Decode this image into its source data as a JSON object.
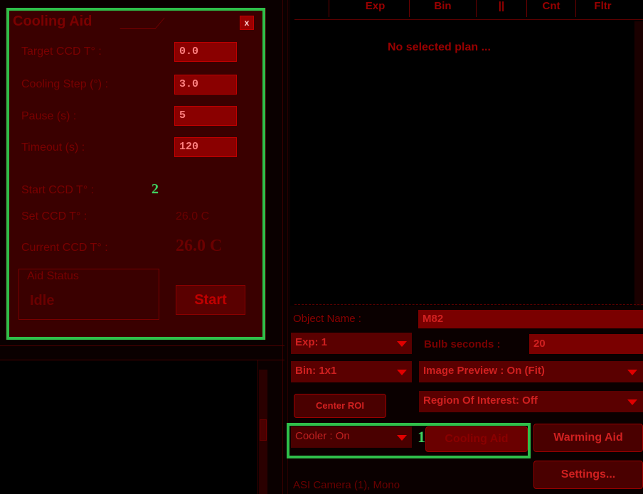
{
  "cooling_aid": {
    "title": "Cooling Aid",
    "close_label": "x",
    "fields": [
      {
        "label": "Target CCD T° :",
        "value": "0.0"
      },
      {
        "label": "Cooling Step (°) :",
        "value": "3.0"
      },
      {
        "label": "Pause (s) :",
        "value": "5"
      },
      {
        "label": "Timeout (s) :",
        "value": "120"
      }
    ],
    "start_ccd_label": "Start CCD T° :",
    "set_ccd_label": "Set CCD T° :",
    "set_ccd_value": "26.0 C",
    "current_ccd_label": "Current CCD T° :",
    "current_ccd_value": "26.0 C",
    "aid_status_caption": "Aid Status",
    "aid_status_value": "Idle",
    "start_label": "Start"
  },
  "annotations": {
    "marker_1": "1",
    "marker_2": "2",
    "color": "#2fbf4a"
  },
  "plan": {
    "columns": [
      "Exp",
      "Bin",
      "||",
      "Cnt",
      "Fltr"
    ],
    "empty_message": "No selected plan ..."
  },
  "controls": {
    "object_name_label": "Object Name :",
    "object_name_value": "M82",
    "exp_select": "Exp: 1",
    "bulb_label": "Bulb seconds :",
    "bulb_value": "20",
    "bin_select": "Bin: 1x1",
    "image_preview_select": "Image Preview : On (Fit)",
    "center_roi_label": "Center ROI",
    "roi_select": "Region Of Interest: Off",
    "cooler_select": "Cooler : On",
    "cooling_aid_button": "Cooling Aid",
    "warming_aid_button": "Warming Aid",
    "settings_button": "Settings...",
    "camera_status": "ASI Camera (1), Mono"
  },
  "colors": {
    "background": "#0a0000",
    "panel": "#3a0000",
    "accent_red": "#c00000",
    "field_red": "#8a0000"
  }
}
